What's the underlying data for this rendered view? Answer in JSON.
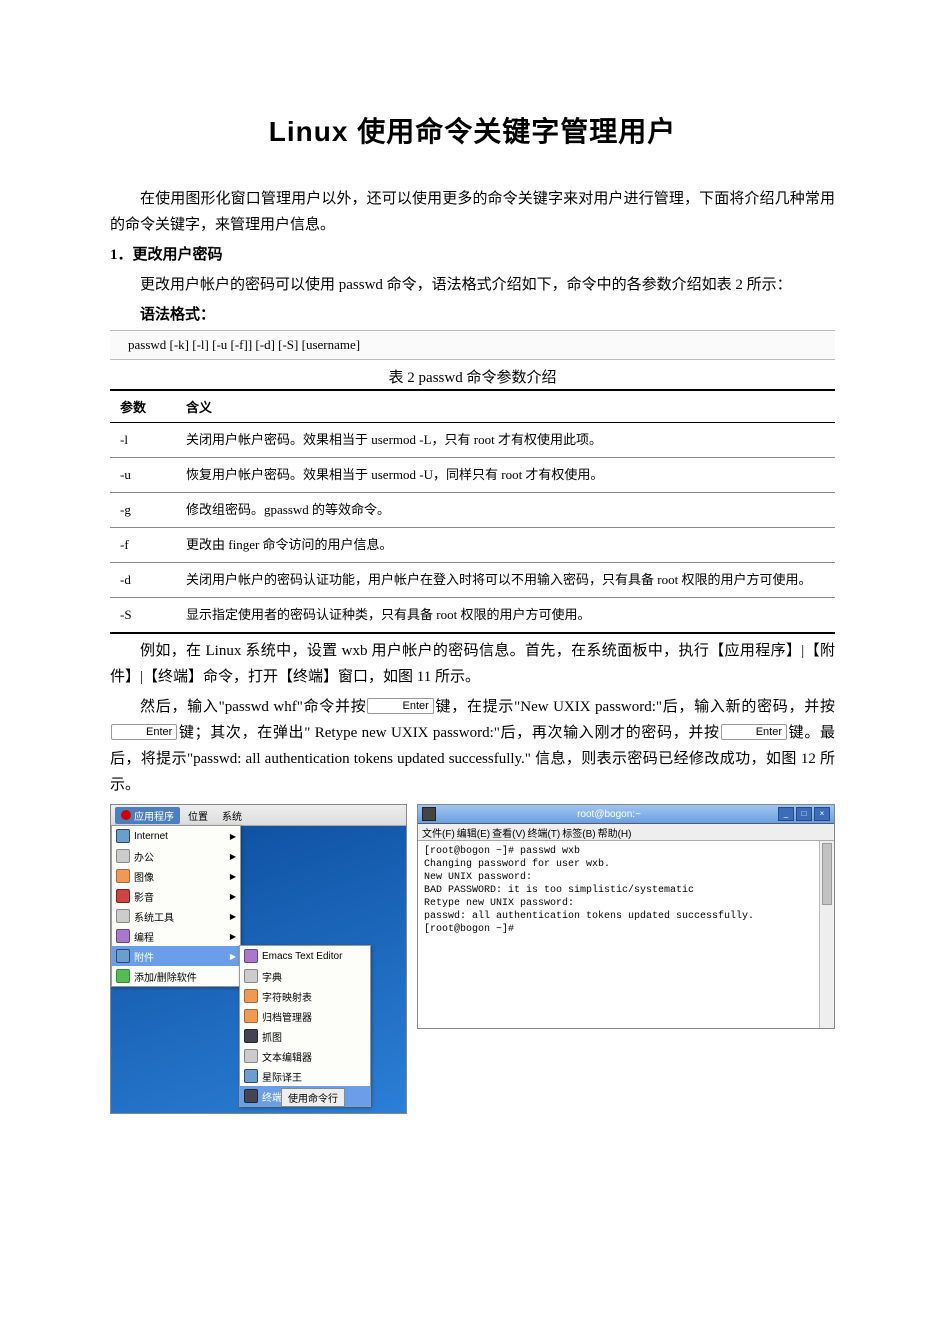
{
  "title": "Linux   使用命令关键字管理用户",
  "intro": "在使用图形化窗口管理用户以外，还可以使用更多的命令关键字来对用户进行管理，下面将介绍几种常用的命令关键字，来管理用户信息。",
  "section1_heading": "1．更改用户密码",
  "section1_p1": "更改用户帐户的密码可以使用 passwd 命令，语法格式介绍如下，命令中的各参数介绍如表 2 所示：",
  "syntax_label": "语法格式：",
  "syntax_code": "passwd  [-k]  [-l]  [-u [-f]]  [-d]  [-S]  [username]",
  "table_caption": "表 2    passwd 命令参数介绍",
  "table": {
    "head_param": "参数",
    "head_meaning": "含义",
    "rows": [
      {
        "param": "-l",
        "meaning": "关闭用户帐户密码。效果相当于 usermod  -L，只有 root 才有权使用此项。"
      },
      {
        "param": "-u",
        "meaning": "恢复用户帐户密码。效果相当于 usermod  -U，同样只有 root 才有权使用。"
      },
      {
        "param": "-g",
        "meaning": "修改组密码。gpasswd 的等效命令。"
      },
      {
        "param": "-f",
        "meaning": "更改由 finger 命令访问的用户信息。"
      },
      {
        "param": "-d",
        "meaning": "关闭用户帐户的密码认证功能，用户帐户在登入时将可以不用输入密码，只有具备 root 权限的用户方可使用。"
      },
      {
        "param": "-S",
        "meaning": "显示指定使用者的密码认证种类，只有具备 root 权限的用户方可使用。"
      }
    ]
  },
  "para2": "例如，在 Linux 系统中，设置 wxb 用户帐户的密码信息。首先，在系统面板中，执行【应用程序】|【附件】|【终端】命令，打开【终端】窗口，如图 11 所示。",
  "para3_pre": "然后，输入\"passwd  whf\"命令并按",
  "key_enter": "Enter",
  "para3_mid1": "键，在提示\"New UXIX password:\"后，输入新的密码，并按",
  "para3_mid2": "键；其次，在弹出\" Retype new UXIX password:\"后，再次输入刚才的密码，并按",
  "para3_end": "键。最后，将提示\"passwd: all authentication tokens updated  successfully.\" 信息，则表示密码已经修改成功，如图 12 所示。",
  "figA": {
    "menubar": {
      "apps": "应用程序",
      "places": "位置",
      "system": "系统"
    },
    "col1": [
      "Internet",
      "办公",
      "图像",
      "影音",
      "系统工具",
      "编程",
      "附件",
      "添加/删除软件"
    ],
    "col2": [
      "Emacs Text Editor",
      "字典",
      "字符映射表",
      "归档管理器",
      "抓图",
      "文本编辑器",
      "星际译王",
      "终端"
    ],
    "run_btn": "使用命令行"
  },
  "figB": {
    "title": "root@bogon:~",
    "menu": [
      "文件(F)",
      "编辑(E)",
      "查看(V)",
      "终端(T)",
      "标签(B)",
      "帮助(H)"
    ],
    "lines": [
      "[root@bogon ~]# passwd wxb",
      "Changing password for user wxb.",
      "New UNIX password:",
      "BAD PASSWORD: it is too simplistic/systematic",
      "Retype new UNIX password:",
      "passwd: all authentication tokens updated successfully.",
      "[root@bogon ~]#"
    ]
  }
}
